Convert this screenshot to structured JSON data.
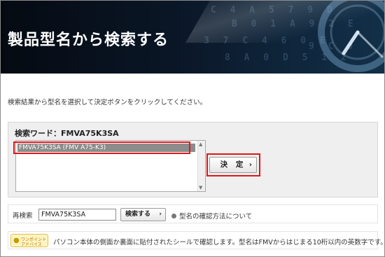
{
  "banner": {
    "title": "製品型名から検索する"
  },
  "instructions": "検索結果から型名を選択して決定ボタンをクリックしてください。",
  "results": {
    "heading": "検索ワード：FMVA75K3SA",
    "items": [
      "FMVA75K3SA (FMV A75-K3)"
    ],
    "decide_label": "決 定"
  },
  "research": {
    "label": "再検索",
    "input_value": "FMVA75K3SA",
    "search_label": "検索する",
    "help_link": "型名の確認方法について"
  },
  "tip": {
    "badge_line1": "ワンポイント",
    "badge_line2": "アドバイス",
    "text": "パソコン本体の側面か裏面に貼付されたシールで確認します。型名はFMVからはじまる10桁以内の英数字です。"
  },
  "icons": {
    "chevron": "chevron-right-icon",
    "bulb": "lightbulb-icon"
  },
  "colors": {
    "highlight": "#e0161b",
    "selected_row": "#8c8c8c"
  }
}
